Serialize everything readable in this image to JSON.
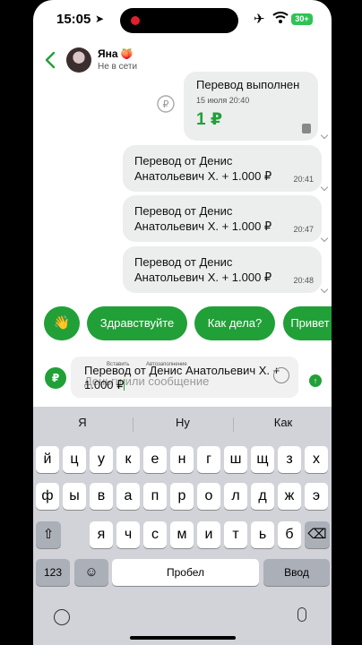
{
  "status_bar": {
    "time": "15:05",
    "battery": "30+"
  },
  "header": {
    "contact_name": "Яна",
    "contact_emoji": "🍑",
    "presence": "Не в сети"
  },
  "chat": {
    "transfer_card": {
      "title": "Перевод выполнен",
      "date": "15 июля 20:40",
      "amount": "1 ₽"
    },
    "messages": [
      {
        "text": "Перевод от Денис Анатольевич Х. + 1.000 ₽",
        "time": "20:41"
      },
      {
        "text": "Перевод от Денис Анатольевич Х. + 1.000 ₽",
        "time": "20:47"
      },
      {
        "text": "Перевод от Денис Анатольевич Х. + 1.000 ₽",
        "time": "20:48"
      }
    ]
  },
  "quick_replies": [
    "👋",
    "Здравствуйте",
    "Как дела?",
    "Привет"
  ],
  "composer": {
    "ruble_label": "₽",
    "context_menu": [
      "Вставить",
      "Автозаполнение"
    ],
    "placeholder": "Деньги или сообщение",
    "value": "Перевод от Денис Анатольевич Х. + 1.000 ₽"
  },
  "keyboard": {
    "suggestions": [
      "Я",
      "Ну",
      "Как"
    ],
    "row1": [
      "й",
      "ц",
      "у",
      "к",
      "е",
      "н",
      "г",
      "ш",
      "щ",
      "з",
      "х"
    ],
    "row2": [
      "ф",
      "ы",
      "в",
      "а",
      "п",
      "р",
      "о",
      "л",
      "д",
      "ж",
      "э"
    ],
    "row3": [
      "я",
      "ч",
      "с",
      "м",
      "и",
      "т",
      "ь",
      "б",
      "ю"
    ],
    "numbers_key": "123",
    "space_key": "Пробел",
    "return_key": "Ввод"
  },
  "colors": {
    "accent": "#21a038",
    "bubble": "#eceded",
    "keyboard_bg": "#d1d3d9"
  }
}
